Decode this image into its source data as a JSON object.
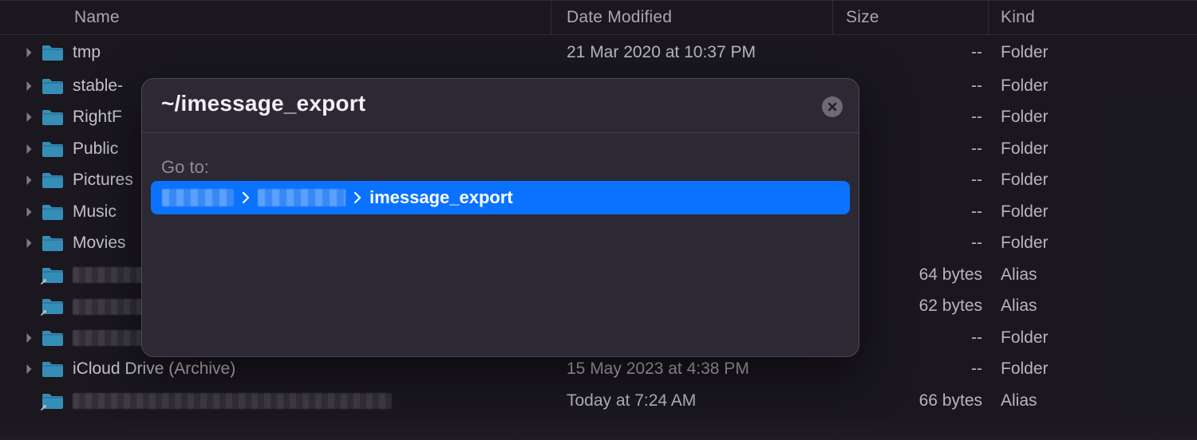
{
  "header": {
    "name": "Name",
    "date": "Date Modified",
    "size": "Size",
    "kind": "Kind"
  },
  "rows": [
    {
      "chevron": true,
      "alias": false,
      "name": "tmp",
      "date": "21 Mar 2020 at 10:37 PM",
      "size": "--",
      "kind": "Folder",
      "redact_name": false
    },
    {
      "chevron": true,
      "alias": false,
      "name": "stable-",
      "date": "",
      "size": "--",
      "kind": "Folder",
      "redact_name": false
    },
    {
      "chevron": true,
      "alias": false,
      "name": "RightF",
      "date": "",
      "size": "--",
      "kind": "Folder",
      "redact_name": false
    },
    {
      "chevron": true,
      "alias": false,
      "name": "Public",
      "date": "",
      "size": "--",
      "kind": "Folder",
      "redact_name": false
    },
    {
      "chevron": true,
      "alias": false,
      "name": "Pictures",
      "date": "",
      "size": "--",
      "kind": "Folder",
      "redact_name": false
    },
    {
      "chevron": true,
      "alias": false,
      "name": "Music",
      "date": "",
      "size": "--",
      "kind": "Folder",
      "redact_name": false
    },
    {
      "chevron": true,
      "alias": false,
      "name": "Movies",
      "date": "",
      "size": "--",
      "kind": "Folder",
      "redact_name": false
    },
    {
      "chevron": false,
      "alias": true,
      "name": "",
      "date": "",
      "size": "64 bytes",
      "kind": "Alias",
      "redact_name": true,
      "redact_w": 110
    },
    {
      "chevron": false,
      "alias": true,
      "name": "",
      "date": "",
      "size": "62 bytes",
      "kind": "Alias",
      "redact_name": true,
      "redact_w": 110
    },
    {
      "chevron": true,
      "alias": false,
      "name": "",
      "date": "",
      "size": "--",
      "kind": "Folder",
      "redact_name": true,
      "redact_w": 120
    },
    {
      "chevron": true,
      "alias": false,
      "name": "iCloud Drive (Archive)",
      "date": "15 May 2023 at 4:38 PM",
      "size": "--",
      "kind": "Folder",
      "redact_name": false
    },
    {
      "chevron": false,
      "alias": true,
      "name": "",
      "date": "Today at 7:24 AM",
      "size": "66 bytes",
      "kind": "Alias",
      "redact_name": true,
      "redact_w": 400
    }
  ],
  "popover": {
    "path": "~/imessage_export",
    "goto_label": "Go to:",
    "suggestion_tail": "imessage_export"
  }
}
